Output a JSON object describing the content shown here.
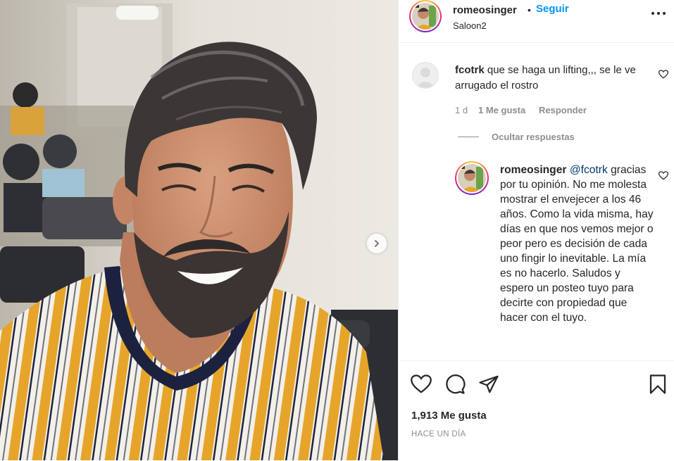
{
  "header": {
    "username": "romeosinger",
    "separator": "•",
    "follow_label": "Seguir",
    "location": "Saloon2",
    "more_icon": "more-horizontal-icon"
  },
  "comments": [
    {
      "username": "fcotrk",
      "text": "que se haga un lifting,,, se le ve arrugado el rostro",
      "time": "1 d",
      "likes": "1 Me gusta",
      "reply_label": "Responder",
      "like_icon": "heart-outline-icon"
    }
  ],
  "hide_replies_label": "Ocultar respuestas",
  "reply": {
    "username": "romeosinger",
    "mention": "@fcotrk",
    "text": "gracias por tu opinión. No me molesta mostrar el envejecer a los 46 años. Como la vida misma, hay días en que nos vemos mejor o peor pero es decisión de cada uno fingir lo inevitable. La mía es no hacerlo. Saludos y espero un posteo tuyo para decirte con propiedad que hacer con el tuyo.",
    "like_icon": "heart-outline-icon"
  },
  "actions": {
    "icons": [
      "heart-outline-icon",
      "comment-icon",
      "share-icon",
      "bookmark-icon"
    ],
    "likes": "1,913 Me gusta",
    "time": "HACE UN DÍA"
  },
  "colors": {
    "accent": "#0095f6",
    "text": "#262626",
    "muted": "#8e8e8e",
    "shirt_yellow": "#e9a92a"
  }
}
